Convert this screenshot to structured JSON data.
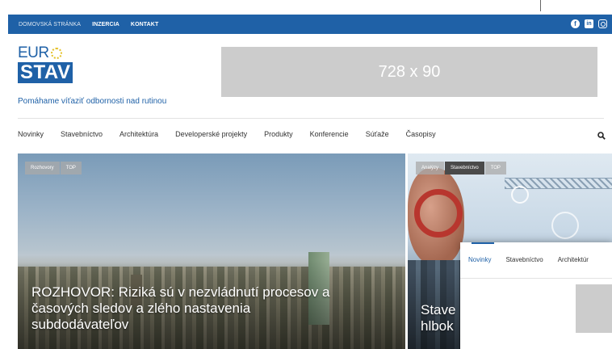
{
  "top_bar": {
    "links": [
      "DOMOVSKÁ STRÁNKA",
      "INZERCIA",
      "KONTAKT"
    ],
    "social_icons": [
      "facebook-icon",
      "linkedin-icon",
      "instagram-icon"
    ],
    "background": "#1f61a7"
  },
  "brand": {
    "logo_top": "EUR",
    "logo_bottom": "STAV",
    "tagline": "Pomáhame víťaziť odbornosti nad rutinou",
    "color": "#1f61a7"
  },
  "banner": {
    "label": "728 x 90"
  },
  "main_nav": {
    "items": [
      "Novinky",
      "Stavebníctvo",
      "Architektúra",
      "Developerské projekty",
      "Produkty",
      "Konferencie",
      "Súťaže",
      "Časopisy"
    ],
    "search_icon": "search-icon"
  },
  "feature_left": {
    "tags": [
      "Rozhovory",
      "TOP"
    ],
    "headline_lines": [
      "ROZHOVOR: Riziká sú v nezvládnutí procesov a",
      "časových sledov a zlého nastavenia",
      "subdodávateľov"
    ]
  },
  "feature_right": {
    "tags": [
      "Analýzy",
      "Stavebníctvo",
      "TOP"
    ],
    "headline_lines": [
      "Stave",
      "hlbok"
    ]
  },
  "overlay_menu": {
    "items": [
      "Novinky",
      "Stavebníctvo",
      "Architektúr"
    ],
    "active_index": 0
  }
}
